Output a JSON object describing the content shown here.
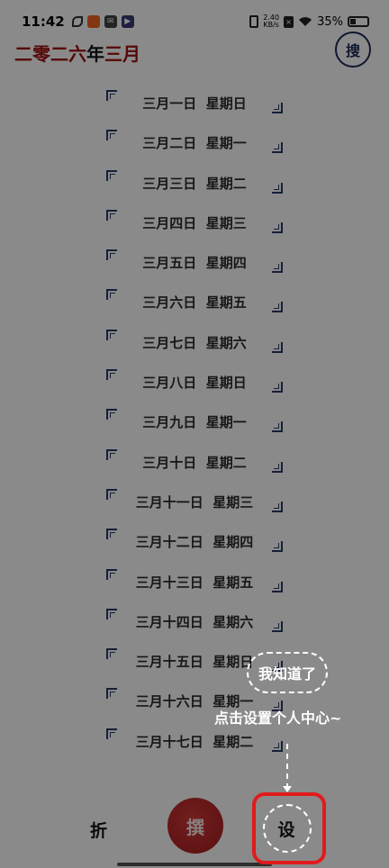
{
  "status_bar": {
    "time": "11:42",
    "net_speed_value": "2.40",
    "net_speed_unit": "KB/s",
    "battery": "35%",
    "icons": [
      "leaf-icon",
      "app-icon",
      "mail-icon",
      "play-icon",
      "vibrate-icon",
      "wifi-icon",
      "battery-icon"
    ]
  },
  "header": {
    "title_parts": [
      {
        "text": "二零二六",
        "color": "#a01010"
      },
      {
        "text": "年",
        "color": "#111111"
      },
      {
        "text": "三月",
        "color": "#a01010"
      }
    ],
    "search_label": "搜"
  },
  "dates": [
    "三月一日  星期日",
    "三月二日  星期一",
    "三月三日  星期二",
    "三月四日  星期三",
    "三月五日  星期四",
    "三月六日  星期五",
    "三月七日  星期六",
    "三月八日  星期日",
    "三月九日  星期一",
    "三月十日  星期二",
    "三月十一日  星期三",
    "三月十二日  星期四",
    "三月十三日  星期五",
    "三月十四日  星期六",
    "三月十五日  星期日",
    "三月十六日  星期一",
    "三月十七日  星期二"
  ],
  "bottom_nav": {
    "fold_label": "折",
    "compose_label": "撰",
    "settings_label": "设"
  },
  "guide": {
    "ok_label": "我知道了",
    "hint": "点击设置个人中心~"
  },
  "colors": {
    "accent_red": "#a01010",
    "highlight_red": "#e11b1b",
    "navy": "#1e2a5a"
  }
}
